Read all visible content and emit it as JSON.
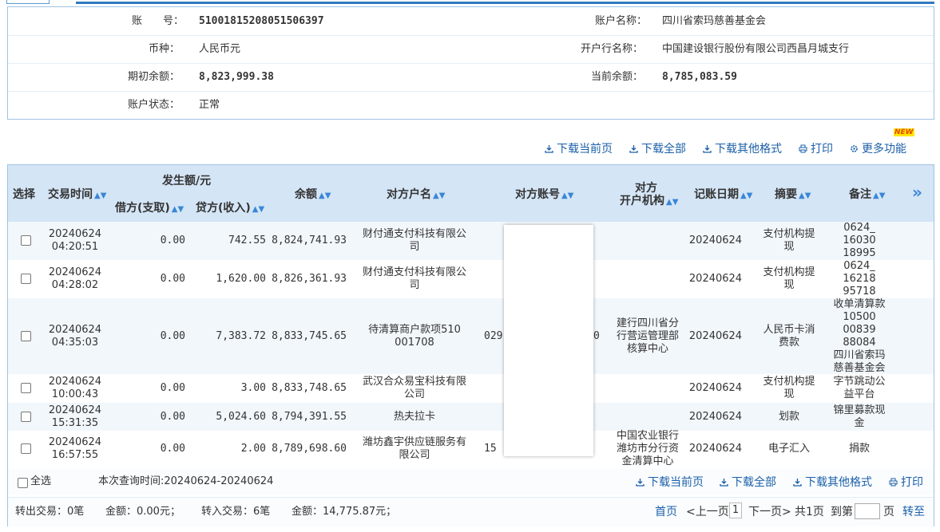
{
  "account": {
    "no_label": "账　　号：",
    "no_value": "51001815208051506397",
    "name_label": "账户名称：",
    "name_value": "四川省索玛慈善基金会",
    "currency_label": "币种：",
    "currency_value": "人民币元",
    "bank_label": "开户行名称：",
    "bank_value": "中国建设银行股份有限公司西昌月城支行",
    "open_label": "期初余额：",
    "open_value": "8,823,999.38",
    "cur_label": "当前余额：",
    "cur_value": "8,785,083.59",
    "status_label": "账户状态：",
    "status_value": "正常"
  },
  "toolbar": {
    "badge": "NEW",
    "download_page": "下载当前页",
    "download_all": "下载全部",
    "download_other": "下载其他格式",
    "print": "打印",
    "more": "更多功能"
  },
  "columns": {
    "select": "选择",
    "time": "交易时间",
    "amount_group": "发生额/元",
    "debit": "借方(支取)",
    "credit": "贷方(收入)",
    "balance": "余额",
    "party_name": "对方户名",
    "party_account": "对方账号",
    "party_bank_1": "对方",
    "party_bank_2": "开户机构",
    "post_date": "记账日期",
    "summary": "摘要",
    "remark": "备注",
    "more": "»",
    "sort_icon": "▲▼"
  },
  "rows": [
    {
      "date": "20240624",
      "time": "04:20:51",
      "debit": "0.00",
      "credit": "742.55",
      "balance": "8,824,741.93",
      "party": [
        "财付通支付科技有限公",
        "司"
      ],
      "acct": "",
      "bank": [],
      "post": "20240624",
      "summary": [
        "支付机构提",
        "现"
      ],
      "remark": [
        "0624_",
        "16030",
        "18995"
      ]
    },
    {
      "date": "20240624",
      "time": "04:28:02",
      "debit": "0.00",
      "credit": "1,620.00",
      "balance": "8,826,361.93",
      "party": [
        "财付通支付科技有限公",
        "司"
      ],
      "acct": "",
      "bank": [],
      "post": "20240624",
      "summary": [
        "支付机构提",
        "现"
      ],
      "remark": [
        "0624_",
        "16218",
        "95718"
      ]
    },
    {
      "date": "20240624",
      "time": "04:35:03",
      "debit": "0.00",
      "credit": "7,383.72",
      "balance": "8,833,745.65",
      "party": [
        "待清算商户款项510",
        "001708"
      ],
      "acct": "029",
      "acct_tail": "0",
      "bank": [
        "建行四川省分",
        "行营运管理部",
        "核算中心"
      ],
      "post": "20240624",
      "summary": [
        "人民币卡消",
        "费款"
      ],
      "remark": [
        "收单清算款",
        "10500",
        "00839",
        "88084",
        "四川省索玛",
        "慈善基金会"
      ]
    },
    {
      "date": "20240624",
      "time": "10:00:43",
      "debit": "0.00",
      "credit": "3.00",
      "balance": "8,833,748.65",
      "party": [
        "武汉合众易宝科技有限",
        "公司"
      ],
      "acct": "",
      "bank": [],
      "post": "20240624",
      "summary": [
        "支付机构提",
        "现"
      ],
      "remark": [
        "字节跳动公",
        "益平台"
      ]
    },
    {
      "date": "20240624",
      "time": "15:31:35",
      "debit": "0.00",
      "credit": "5,024.60",
      "balance": "8,794,391.55",
      "party": [
        "热夫拉卡"
      ],
      "acct": "",
      "bank": [],
      "post": "20240624",
      "summary": [
        "划款"
      ],
      "remark": [
        "锦里募款现",
        "金"
      ]
    },
    {
      "date": "20240624",
      "time": "16:57:55",
      "debit": "0.00",
      "credit": "2.00",
      "balance": "8,789,698.60",
      "party": [
        "潍坊鑫宇供应链服务有",
        "限公司"
      ],
      "acct": "15",
      "bank": [
        "中国农业银行",
        "潍坊市分行资",
        "金清算中心"
      ],
      "post": "20240624",
      "summary": [
        "电子汇入"
      ],
      "remark": [
        "捐款"
      ]
    }
  ],
  "footer": {
    "select_all": "全选",
    "query_time": "本次查询时间:20240624-20240624",
    "download_page": "下载当前页",
    "download_all": "下载全部",
    "download_other": "下载其他格式",
    "print": "打印",
    "out_count": "转出交易：0笔",
    "out_amount": "金额：0.00元；",
    "in_count": "转入交易：6笔",
    "in_amount": "金额：14,775.87元；",
    "first": "首页",
    "prev": "<上一页",
    "page": "1",
    "next": "下一页>",
    "total": "共1页",
    "goto_pre": "到第",
    "goto_post": "页",
    "go": "转至"
  }
}
